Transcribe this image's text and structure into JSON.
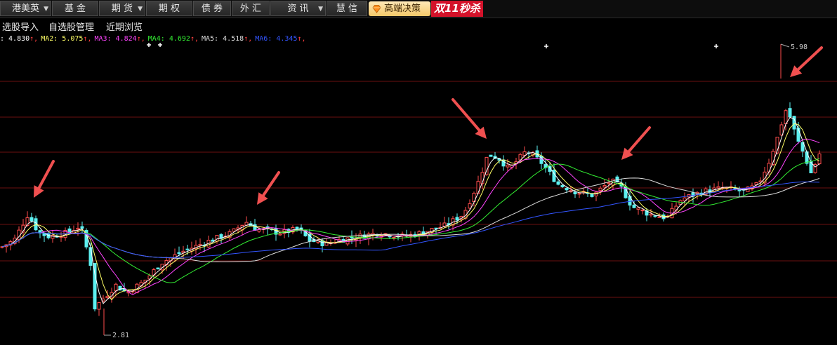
{
  "menu": {
    "items": [
      {
        "label": "港美英",
        "dropdown": true
      },
      {
        "label": "基 金",
        "dropdown": false
      },
      {
        "label": "期 货",
        "dropdown": true
      },
      {
        "label": "期 权",
        "dropdown": false
      },
      {
        "label": "债 券",
        "dropdown": false
      },
      {
        "label": "外 汇",
        "dropdown": false
      },
      {
        "label": "资 讯",
        "dropdown": true
      },
      {
        "label": "慧 信",
        "dropdown": false
      }
    ],
    "promo_label": "高端决策",
    "sale_label": "双11秒杀"
  },
  "toolbar": {
    "items": [
      "选股导入",
      "自选股管理",
      "近期浏览"
    ]
  },
  "ma_legend": [
    {
      "label": ": 4.830",
      "color": "#ffffff"
    },
    {
      "label": "MA2: 5.075",
      "color": "#ffff66"
    },
    {
      "label": "MA3: 4.824",
      "color": "#ff44ff"
    },
    {
      "label": "MA4: 4.692",
      "color": "#33ee33"
    },
    {
      "label": "MA5: 4.518",
      "color": "#dddddd"
    },
    {
      "label": "MA6: 4.345",
      "color": "#3355ff"
    }
  ],
  "chart_data": {
    "type": "candlestick",
    "high_label": "5.98",
    "low_label": "2.81",
    "colors": {
      "up": "#ff4d4d",
      "down": "#5cf0f0",
      "grid": "#6b0f0f",
      "arrow": "#f05050"
    }
  }
}
